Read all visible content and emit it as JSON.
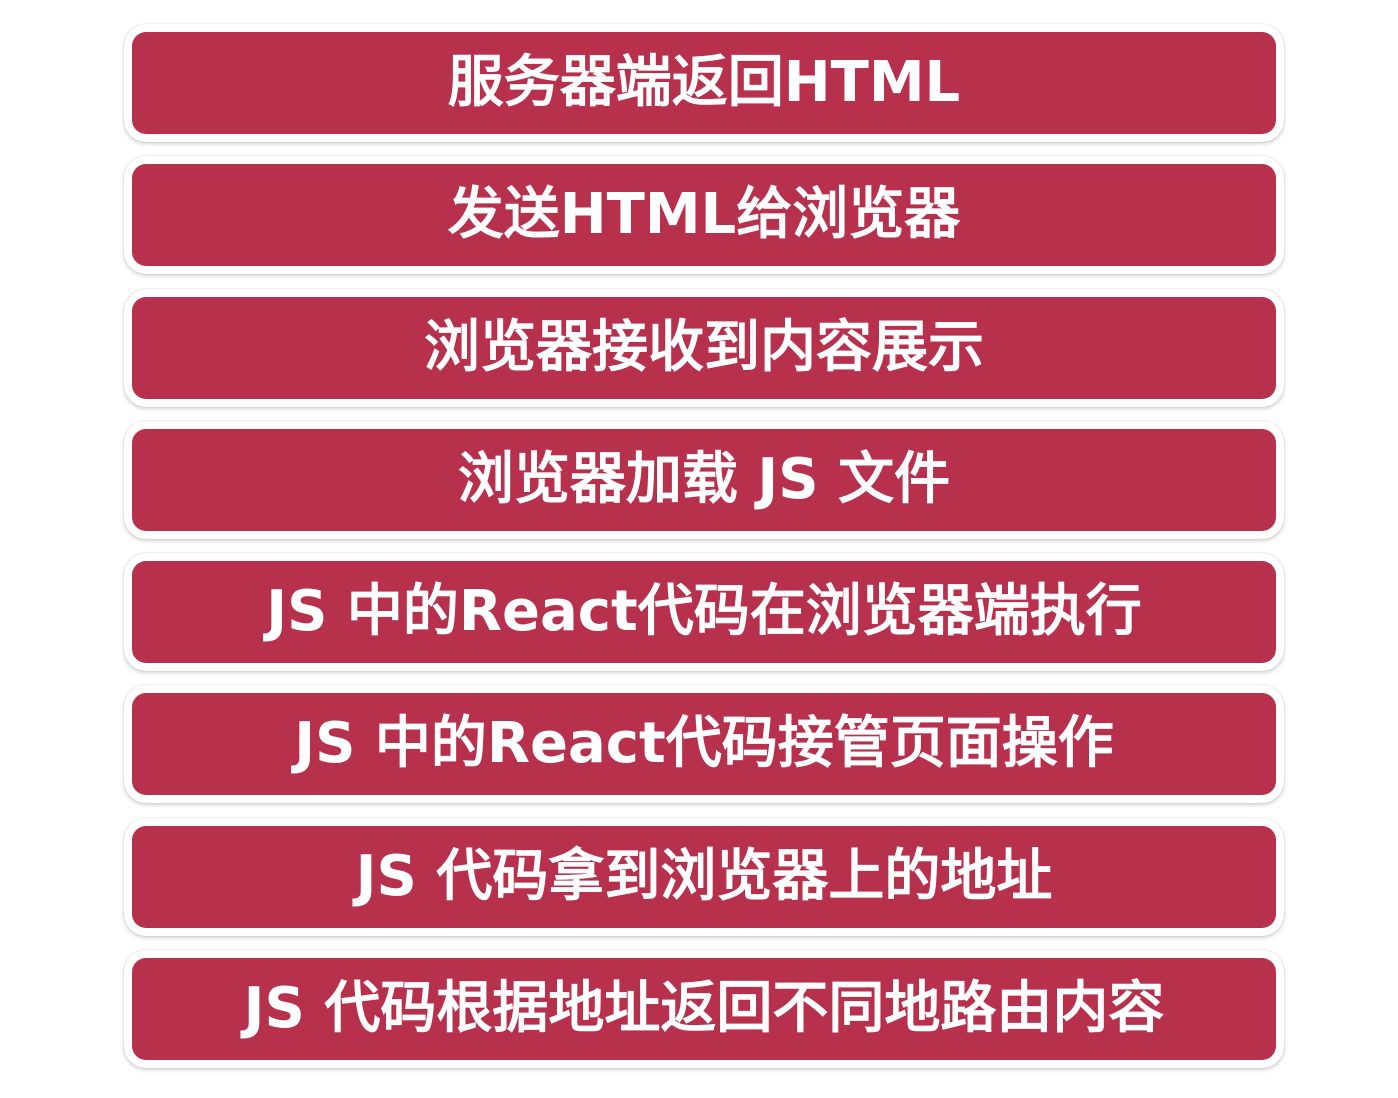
{
  "colors": {
    "box_fill": "#b7304c",
    "box_border": "#ffffff",
    "text": "#ffffff"
  },
  "steps": [
    {
      "label": "服务器端返回HTML"
    },
    {
      "label": "发送HTML给浏览器"
    },
    {
      "label": "浏览器接收到内容展示"
    },
    {
      "label": "浏览器加载 JS 文件"
    },
    {
      "label": "JS 中的React代码在浏览器端执行"
    },
    {
      "label": "JS 中的React代码接管页面操作"
    },
    {
      "label": "JS 代码拿到浏览器上的地址"
    },
    {
      "label": "JS 代码根据地址返回不同地路由内容"
    }
  ]
}
